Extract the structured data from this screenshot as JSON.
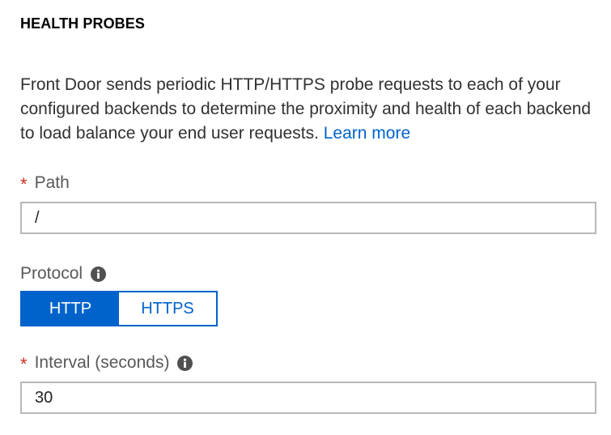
{
  "section": {
    "title": "HEALTH PROBES",
    "description": "Front Door sends periodic HTTP/HTTPS probe requests to each of your configured backends to determine the proximity and health of each backend to load balance your end user requests.",
    "learn_more": "Learn more"
  },
  "path_field": {
    "required_marker": "*",
    "label": "Path",
    "value": "/"
  },
  "protocol_field": {
    "label": "Protocol",
    "options": [
      "HTTP",
      "HTTPS"
    ],
    "selected": "HTTP"
  },
  "interval_field": {
    "required_marker": "*",
    "label": "Interval (seconds)",
    "value": "30"
  },
  "colors": {
    "accent": "#0063cc",
    "required": "#d52b1e",
    "border": "#b8b8b8"
  },
  "icons": {
    "info": "info-icon"
  }
}
